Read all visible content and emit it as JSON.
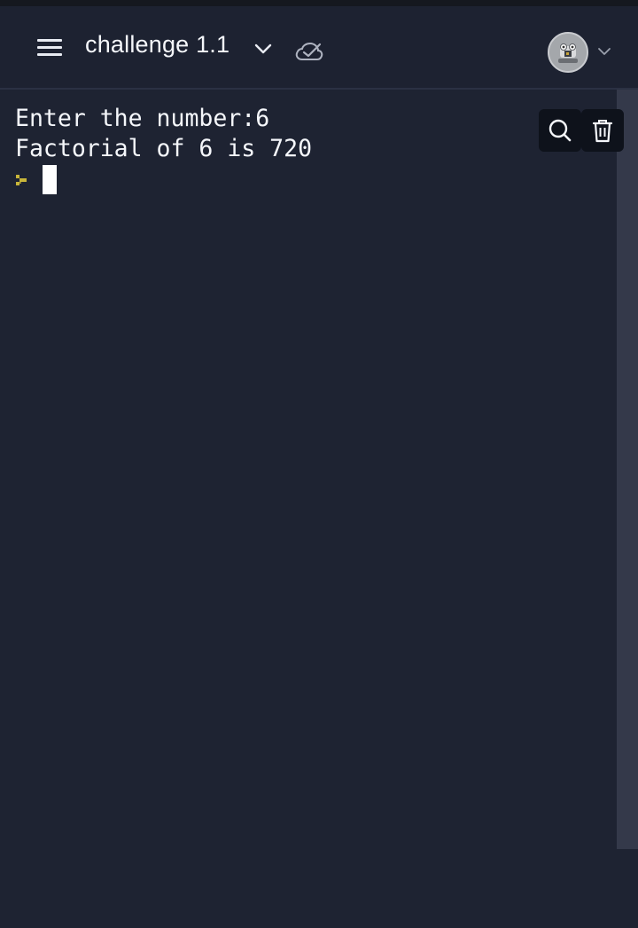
{
  "header": {
    "title": "challenge 1.1",
    "icons": [
      "menu-icon",
      "chevron-down-icon",
      "check-cloud-icon",
      "avatar",
      "chevron-down-icon"
    ]
  },
  "console": {
    "lines": [
      "Enter the number:6",
      "Factorial of 6 is 720"
    ],
    "prompt_icon": "prompt-arrow-icon",
    "prompt_color": "#c8b53a"
  },
  "toolbar": {
    "icons": [
      "search-icon",
      "trash-icon"
    ]
  },
  "colors": {
    "background": "#1e2332",
    "header": "#1d2231",
    "scrollbar": "#34394a",
    "text": "#f5f7fb"
  }
}
